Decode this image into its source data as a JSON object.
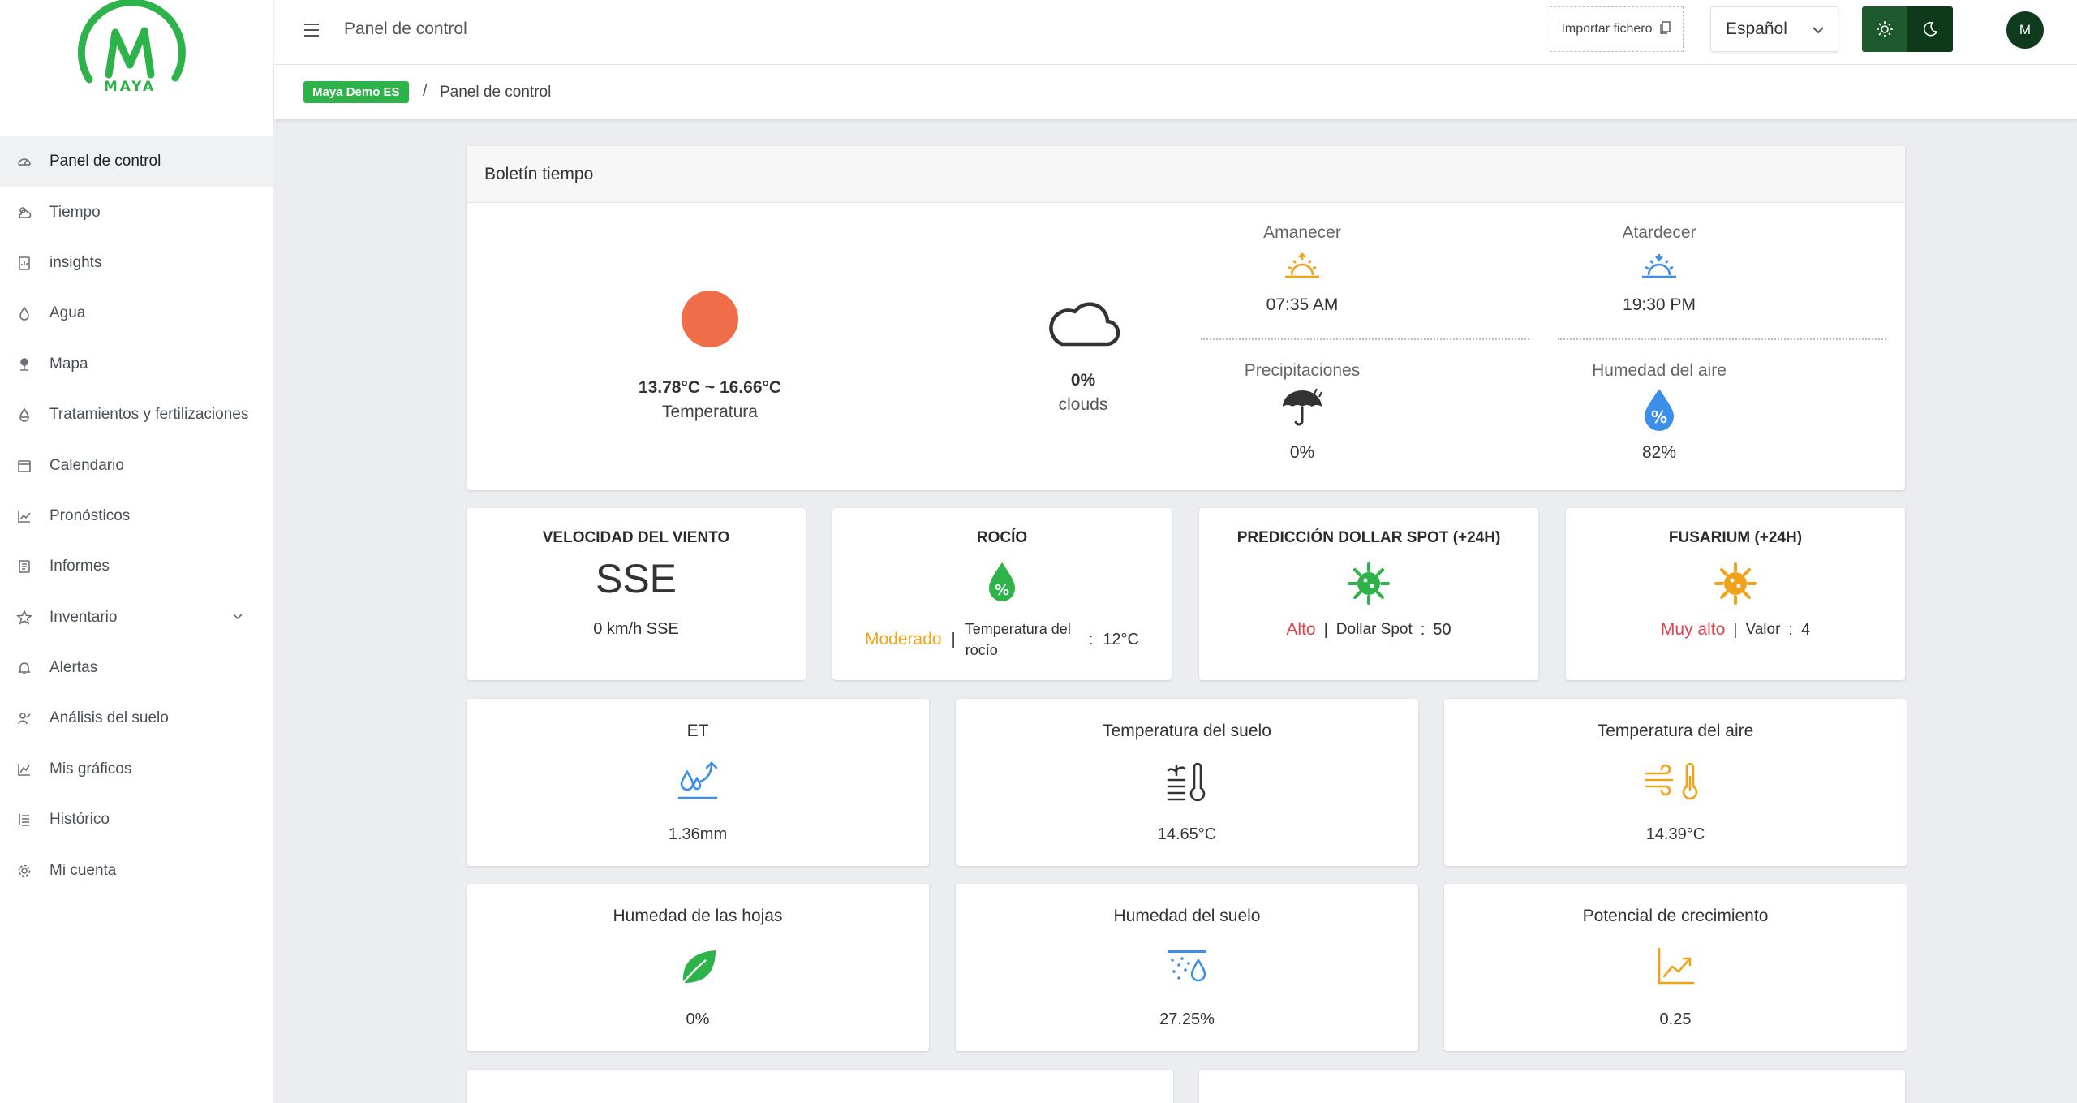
{
  "colors": {
    "brand_green": "#2db34a",
    "orange": "#f0a21c",
    "red": "#e0434a",
    "sun": "#ef6e49",
    "blue": "#3b8fe8"
  },
  "logo": {
    "text": "MAYA"
  },
  "sidebar": {
    "items": [
      {
        "label": "Panel de control",
        "icon": "dashboard-icon"
      },
      {
        "label": "Tiempo",
        "icon": "weather-icon"
      },
      {
        "label": "insights",
        "icon": "clipboard-icon"
      },
      {
        "label": "Agua",
        "icon": "drop-icon"
      },
      {
        "label": "Mapa",
        "icon": "map-pin-icon"
      },
      {
        "label": "Tratamientos y fertilizaciones",
        "icon": "flask-icon"
      },
      {
        "label": "Calendario",
        "icon": "calendar-icon"
      },
      {
        "label": "Pronósticos",
        "icon": "trend-icon"
      },
      {
        "label": "Informes",
        "icon": "report-icon"
      },
      {
        "label": "Inventario",
        "icon": "star-icon"
      },
      {
        "label": "Alertas",
        "icon": "bell-icon"
      },
      {
        "label": "Análisis del suelo",
        "icon": "soil-icon"
      },
      {
        "label": "Mis gráficos",
        "icon": "chart-icon"
      },
      {
        "label": "Histórico",
        "icon": "history-icon"
      },
      {
        "label": "Mi cuenta",
        "icon": "gear-icon"
      }
    ]
  },
  "header": {
    "title": "Panel de control",
    "import_label": "Importar fichero",
    "language": "Español",
    "avatar_initial": "M"
  },
  "breadcrumb": {
    "badge": "Maya Demo ES",
    "separator": "/",
    "current": "Panel de control"
  },
  "weather": {
    "title": "Boletín tiempo",
    "temperature_range": "13.78°C ~ 16.66°C",
    "temperature_label": "Temperatura",
    "clouds_value": "0%",
    "clouds_label": "clouds",
    "sunrise_label": "Amanecer",
    "sunrise_time": "07:35 AM",
    "sunset_label": "Atardecer",
    "sunset_time": "19:30 PM",
    "precip_label": "Precipitaciones",
    "precip_value": "0%",
    "humidity_label": "Humedad del aire",
    "humidity_value": "82%"
  },
  "wind": {
    "title": "VELOCIDAD DEL VIENTO",
    "direction": "SSE",
    "speed": "0 km/h SSE"
  },
  "dew": {
    "title": "ROCÍO",
    "level": "Moderado",
    "sep": "|",
    "label": "Temperatura del rocío",
    "colon": ":",
    "value": "12°C"
  },
  "dollar": {
    "title": "PREDICCIÓN DOLLAR SPOT (+24H)",
    "level": "Alto",
    "sep": "|",
    "label": "Dollar Spot",
    "colon": ":",
    "value": "50"
  },
  "fusarium": {
    "title": "FUSARIUM (+24H)",
    "level": "Muy alto",
    "sep": "|",
    "label": "Valor",
    "colon": ":",
    "value": "4"
  },
  "metrics": [
    {
      "title": "ET",
      "value": "1.36mm",
      "icon": "evapotranspiration-icon"
    },
    {
      "title": "Temperatura del suelo",
      "value": "14.65°C",
      "icon": "soil-temperature-icon"
    },
    {
      "title": "Temperatura del aire",
      "value": "14.39°C",
      "icon": "air-temperature-icon"
    },
    {
      "title": "Humedad de las hojas",
      "value": "0%",
      "icon": "leaf-icon"
    },
    {
      "title": "Humedad del suelo",
      "value": "27.25%",
      "icon": "soil-moisture-icon"
    },
    {
      "title": "Potencial de crecimiento",
      "value": "0.25",
      "icon": "growth-chart-icon"
    }
  ]
}
